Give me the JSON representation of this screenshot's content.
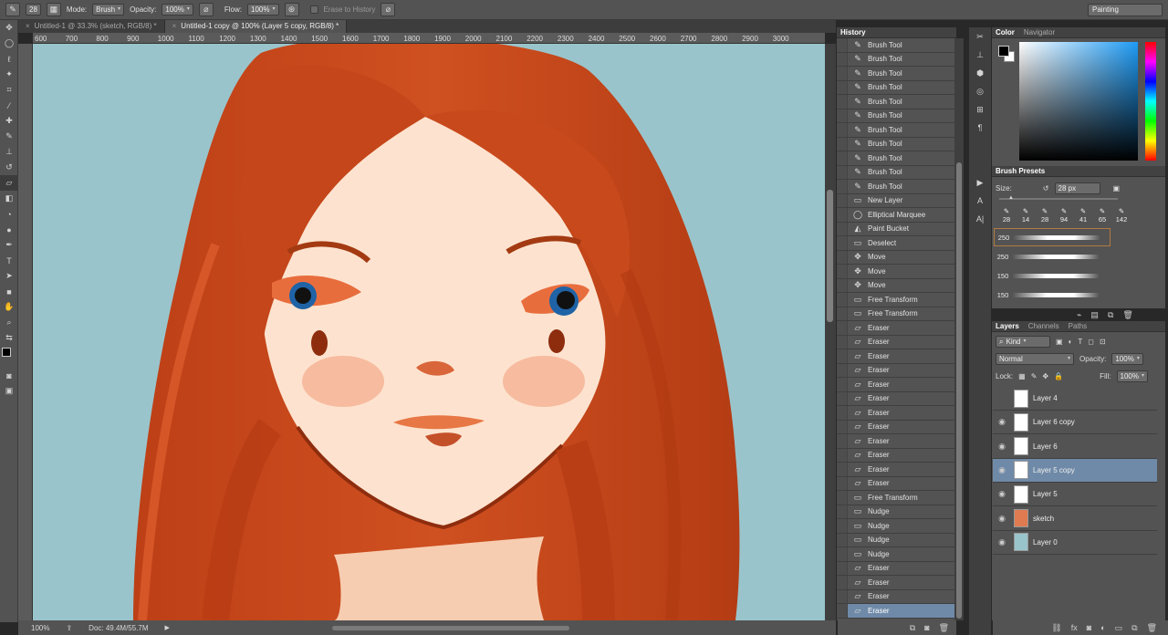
{
  "options_bar": {
    "brush_size": "28",
    "mode_label": "Mode:",
    "mode_value": "Brush",
    "opacity_label": "Opacity:",
    "opacity_value": "100%",
    "flow_label": "Flow:",
    "flow_value": "100%",
    "erase_history": "Erase to History",
    "workspace": "Painting"
  },
  "doc_tabs": [
    {
      "label": "Untitled-1 @ 33.3% (sketch, RGB/8) *"
    },
    {
      "label": "Untitled-1 copy @ 100% (Layer 5 copy, RGB/8) *"
    }
  ],
  "ruler_ticks": [
    "600",
    "700",
    "800",
    "900",
    "1000",
    "1100",
    "1200",
    "1300",
    "1400",
    "1500",
    "1600",
    "1700",
    "1800",
    "1900",
    "2000",
    "2100",
    "2200",
    "2300",
    "2400",
    "2500",
    "2600",
    "2700",
    "2800",
    "2900",
    "3000"
  ],
  "status": {
    "zoom": "100%",
    "doc": "Doc: 49.4M/55.7M"
  },
  "history": {
    "title": "History",
    "items": [
      {
        "label": "Brush Tool",
        "icon": "brush-icon"
      },
      {
        "label": "Brush Tool",
        "icon": "brush-icon"
      },
      {
        "label": "Brush Tool",
        "icon": "brush-icon"
      },
      {
        "label": "Brush Tool",
        "icon": "brush-icon"
      },
      {
        "label": "Brush Tool",
        "icon": "brush-icon"
      },
      {
        "label": "Brush Tool",
        "icon": "brush-icon"
      },
      {
        "label": "Brush Tool",
        "icon": "brush-icon"
      },
      {
        "label": "Brush Tool",
        "icon": "brush-icon"
      },
      {
        "label": "Brush Tool",
        "icon": "brush-icon"
      },
      {
        "label": "Brush Tool",
        "icon": "brush-icon"
      },
      {
        "label": "Brush Tool",
        "icon": "brush-icon"
      },
      {
        "label": "New Layer",
        "icon": "layer-icon"
      },
      {
        "label": "Elliptical Marquee",
        "icon": "ellipse-icon"
      },
      {
        "label": "Paint Bucket",
        "icon": "bucket-icon"
      },
      {
        "label": "Deselect",
        "icon": "layer-icon"
      },
      {
        "label": "Move",
        "icon": "move-icon"
      },
      {
        "label": "Move",
        "icon": "move-icon"
      },
      {
        "label": "Move",
        "icon": "move-icon"
      },
      {
        "label": "Free Transform",
        "icon": "layer-icon"
      },
      {
        "label": "Free Transform",
        "icon": "layer-icon"
      },
      {
        "label": "Eraser",
        "icon": "eraser-icon"
      },
      {
        "label": "Eraser",
        "icon": "eraser-icon"
      },
      {
        "label": "Eraser",
        "icon": "eraser-icon"
      },
      {
        "label": "Eraser",
        "icon": "eraser-icon"
      },
      {
        "label": "Eraser",
        "icon": "eraser-icon"
      },
      {
        "label": "Eraser",
        "icon": "eraser-icon"
      },
      {
        "label": "Eraser",
        "icon": "eraser-icon"
      },
      {
        "label": "Eraser",
        "icon": "eraser-icon"
      },
      {
        "label": "Eraser",
        "icon": "eraser-icon"
      },
      {
        "label": "Eraser",
        "icon": "eraser-icon"
      },
      {
        "label": "Eraser",
        "icon": "eraser-icon"
      },
      {
        "label": "Eraser",
        "icon": "eraser-icon"
      },
      {
        "label": "Free Transform",
        "icon": "layer-icon"
      },
      {
        "label": "Nudge",
        "icon": "layer-icon"
      },
      {
        "label": "Nudge",
        "icon": "layer-icon"
      },
      {
        "label": "Nudge",
        "icon": "layer-icon"
      },
      {
        "label": "Nudge",
        "icon": "layer-icon"
      },
      {
        "label": "Eraser",
        "icon": "eraser-icon"
      },
      {
        "label": "Eraser",
        "icon": "eraser-icon"
      },
      {
        "label": "Eraser",
        "icon": "eraser-icon"
      },
      {
        "label": "Eraser",
        "icon": "eraser-icon"
      }
    ]
  },
  "color_panel": {
    "tab1": "Color",
    "tab2": "Navigator",
    "foreground": "#000000",
    "background": "#ffffff"
  },
  "brush_presets": {
    "title": "Brush Presets",
    "size_label": "Size:",
    "size_value": "28 px",
    "tips": [
      "28",
      "14",
      "28",
      "94",
      "41",
      "65",
      "142"
    ],
    "strokes": [
      "250",
      "250",
      "150",
      "150"
    ]
  },
  "layers_panel": {
    "tabs": [
      "Layers",
      "Channels",
      "Paths"
    ],
    "kind": "Kind",
    "blend_mode": "Normal",
    "opacity_label": "Opacity:",
    "opacity_value": "100%",
    "lock_label": "Lock:",
    "fill_label": "Fill:",
    "fill_value": "100%",
    "layers": [
      {
        "name": "Layer 4",
        "visible": false,
        "selected": false
      },
      {
        "name": "Layer 6 copy",
        "visible": true,
        "selected": false
      },
      {
        "name": "Layer 6",
        "visible": true,
        "selected": false
      },
      {
        "name": "Layer 5 copy",
        "visible": true,
        "selected": true
      },
      {
        "name": "Layer 5",
        "visible": true,
        "selected": false
      },
      {
        "name": "sketch",
        "visible": true,
        "selected": false
      },
      {
        "name": "Layer 0",
        "visible": true,
        "selected": false
      }
    ]
  },
  "colors": {
    "canvas_bg": "#9ac4cb",
    "hair": "#c5471a",
    "skin": "#fde3cf",
    "selection": "#6f8aa8"
  }
}
